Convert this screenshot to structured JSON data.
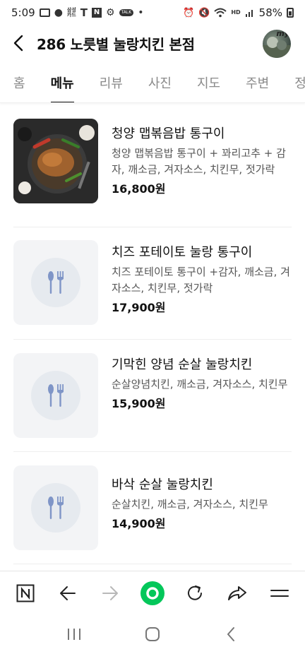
{
  "status_bar": {
    "time": "5:09",
    "carrier_small_line1": "삼성",
    "carrier_small_line2": "카드",
    "talk_badge": "TALK",
    "hd_label": "HD",
    "battery": "58%"
  },
  "header": {
    "title": "286 노릇별 눌랑치킨 본점",
    "avatar_text": "my"
  },
  "tabs": [
    {
      "label": "홈",
      "active": false
    },
    {
      "label": "메뉴",
      "active": true
    },
    {
      "label": "리뷰",
      "active": false
    },
    {
      "label": "사진",
      "active": false
    },
    {
      "label": "지도",
      "active": false
    },
    {
      "label": "주변",
      "active": false
    },
    {
      "label": "정",
      "active": false
    }
  ],
  "menu_items": [
    {
      "name": "청양 맵볶음밥 통구이",
      "description": "청양 맵볶음밥 통구이 + 꽈리고추 + 감자, 깨소금, 겨자소스, 치킨무, 젓가락",
      "price": "16,800원",
      "has_photo": true
    },
    {
      "name": "치즈 포테이토 눌랑 통구이",
      "description": "치즈 포테이토 통구이 +감자, 깨소금, 겨자소스, 치킨무, 젓가락",
      "price": "17,900원",
      "has_photo": false
    },
    {
      "name": "기막힌 양념 순살 눌랑치킨",
      "description": "순살양념치킨, 깨소금, 겨자소스, 치킨무",
      "price": "15,900원",
      "has_photo": false
    },
    {
      "name": "바삭 순살 눌랑치킨",
      "description": "순살치킨, 깨소금, 겨자소스, 치킨무",
      "price": "14,900원",
      "has_photo": false
    }
  ],
  "browser_toolbar": {
    "icons": [
      "naver-n-icon",
      "back-arrow-icon",
      "forward-arrow-icon",
      "green-circle-icon",
      "refresh-icon",
      "share-icon",
      "menu-icon"
    ],
    "accent_color": "#03c75a"
  },
  "system_nav": {
    "icons": [
      "recent-apps-icon",
      "home-icon",
      "back-icon"
    ]
  }
}
